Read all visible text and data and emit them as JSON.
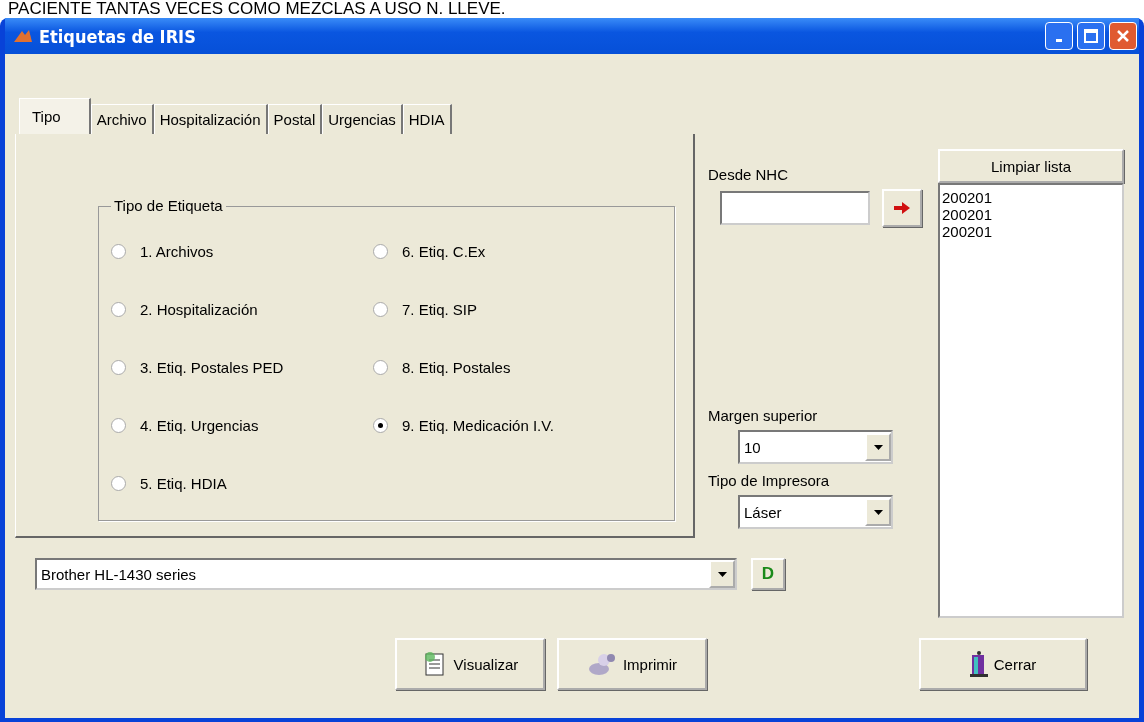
{
  "banner": "PACIENTE TANTAS VECES COMO MEZCLAS A USO N. LLEVE.",
  "window": {
    "title": "Etiquetas de IRIS"
  },
  "tabs": [
    {
      "label": "Tipo",
      "selected": true
    },
    {
      "label": "Archivo",
      "selected": false
    },
    {
      "label": "Hospitalización",
      "selected": false
    },
    {
      "label": "Postal",
      "selected": false
    },
    {
      "label": "Urgencias",
      "selected": false
    },
    {
      "label": "HDIA",
      "selected": false
    }
  ],
  "group": {
    "title": "Tipo de Etiqueta",
    "options": [
      {
        "label": "1. Archivos",
        "selected": false
      },
      {
        "label": "2. Hospitalización",
        "selected": false
      },
      {
        "label": "3. Etiq. Postales PED",
        "selected": false
      },
      {
        "label": "4. Etiq. Urgencias",
        "selected": false
      },
      {
        "label": "5. Etiq. HDIA",
        "selected": false
      },
      {
        "label": "6. Etiq. C.Ex",
        "selected": false
      },
      {
        "label": "7. Etiq. SIP",
        "selected": false
      },
      {
        "label": "8. Etiq. Postales",
        "selected": false
      },
      {
        "label": "9. Etiq. Medicación I.V.",
        "selected": true
      }
    ]
  },
  "nhc": {
    "label": "Desde  NHC"
  },
  "clear_button": "Limpiar lista",
  "list": [
    "200201",
    "200201",
    "200201"
  ],
  "margin": {
    "label": "Margen superior",
    "value": "10"
  },
  "printer_type": {
    "label": "Tipo de Impresora",
    "value": "Láser"
  },
  "printer": {
    "value": "Brother HL-1430 series",
    "button": "D"
  },
  "buttons": [
    {
      "label": "Visualizar",
      "kind": "preview"
    },
    {
      "label": "Imprimir",
      "kind": "print"
    }
  ],
  "close_button": "Cerrar"
}
